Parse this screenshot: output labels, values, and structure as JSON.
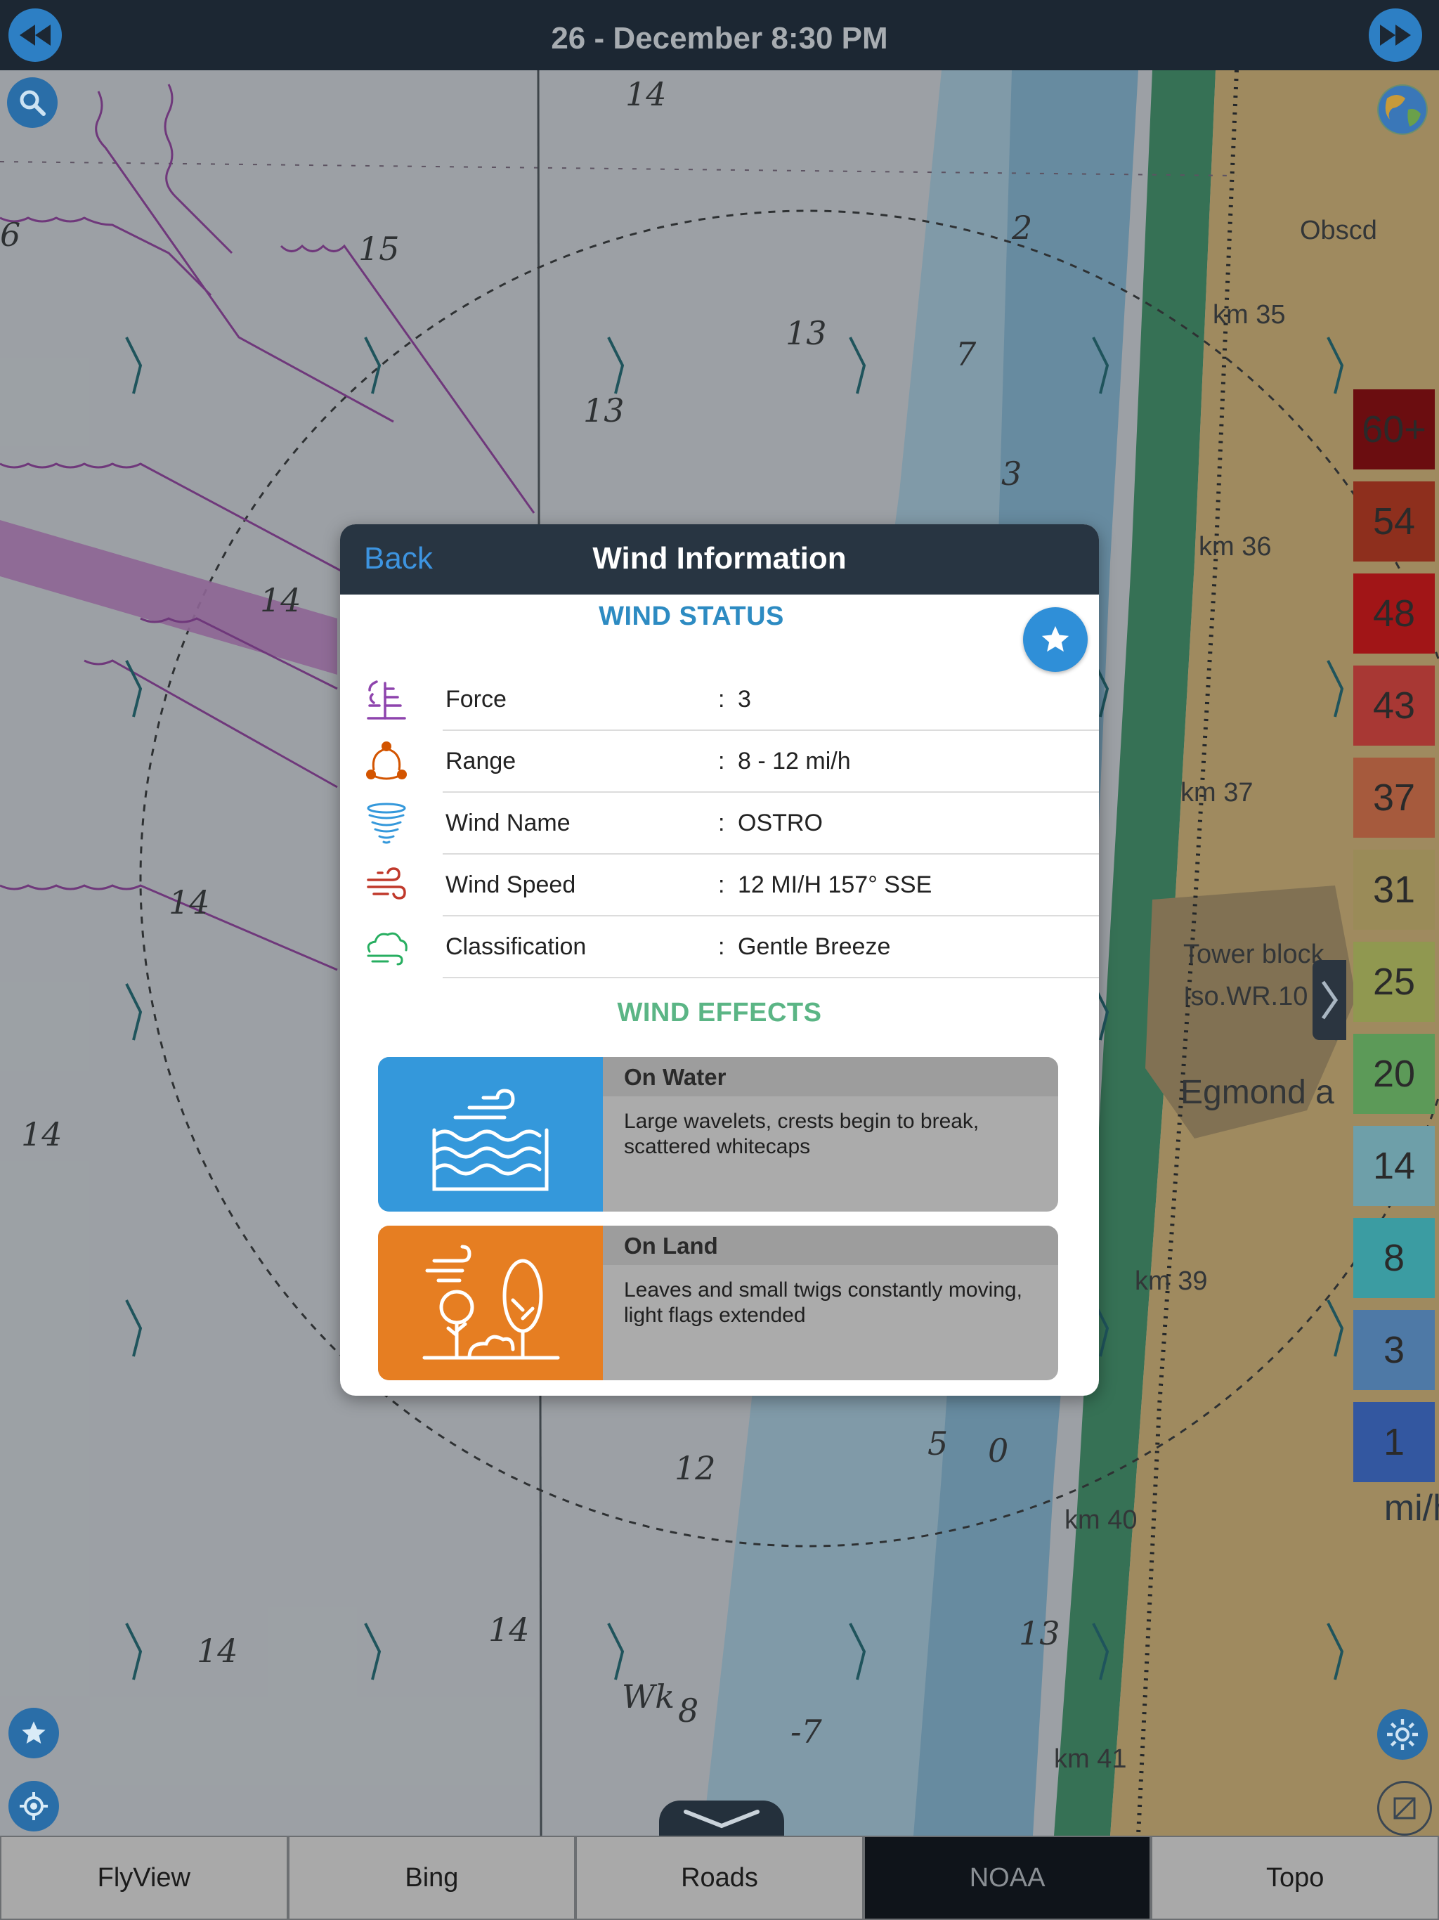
{
  "topbar": {
    "datetime": "26 - December  8:30 PM",
    "prev_icon": "rewind-icon",
    "next_icon": "fast-forward-icon"
  },
  "map": {
    "depth_labels": [
      "14",
      "15",
      "13",
      "13",
      "7",
      "3",
      "6",
      "14",
      "14",
      "14",
      "12",
      "14",
      "14",
      "5",
      "0",
      "2",
      "13",
      "Wk",
      "8",
      "-7"
    ],
    "place_labels": [
      "Obscd",
      "km 35",
      "km 36",
      "km 37",
      "Tower block",
      "Iso.WR.10",
      "Egmond a",
      "km 39",
      "km 40",
      "km 41"
    ]
  },
  "legend": {
    "unit": "mi/h",
    "items": [
      {
        "label": "60+",
        "color": "#6b0d10"
      },
      {
        "label": "54",
        "color": "#8e2f1d"
      },
      {
        "label": "48",
        "color": "#a11517"
      },
      {
        "label": "43",
        "color": "#a83834"
      },
      {
        "label": "37",
        "color": "#a65a3d"
      },
      {
        "label": "31",
        "color": "#9a8b58"
      },
      {
        "label": "25",
        "color": "#909850"
      },
      {
        "label": "20",
        "color": "#5c9a58"
      },
      {
        "label": "14",
        "color": "#6e9fa9"
      },
      {
        "label": "8",
        "color": "#3b9ca2"
      },
      {
        "label": "3",
        "color": "#4e79a6"
      },
      {
        "label": "1",
        "color": "#3357a0"
      }
    ]
  },
  "dialog": {
    "back": "Back",
    "title": "Wind Information",
    "status_title": "WIND STATUS",
    "status_color": "#2d8bc2",
    "effects_title": "WIND EFFECTS",
    "effects_color": "#5bb585",
    "rows": [
      {
        "label": "Force",
        "sep": ":",
        "value": "3",
        "icon": "force-plant-icon",
        "color": "#8e44ad"
      },
      {
        "label": "Range",
        "sep": ":",
        "value": "8 - 12  mi/h",
        "icon": "range-icon",
        "color": "#d35400"
      },
      {
        "label": "Wind Name",
        "sep": ":",
        "value": "OSTRO",
        "icon": "tornado-icon",
        "color": "#3498db"
      },
      {
        "label": "Wind Speed",
        "sep": ":",
        "value": "12 MI/H 157° SSE",
        "icon": "wind-speed-icon",
        "color": "#c0392b"
      },
      {
        "label": "Classification",
        "sep": ":",
        "value": "Gentle Breeze",
        "icon": "cloud-wind-icon",
        "color": "#27ae60"
      }
    ],
    "effects": [
      {
        "title": "On Water",
        "text": "Large wavelets, crests begin to break, scattered whitecaps",
        "icon": "water-waves-icon",
        "color": "#3498db"
      },
      {
        "title": "On Land",
        "text": "Leaves and small twigs constantly moving, light flags extended",
        "icon": "trees-wind-icon",
        "color": "#e67e22"
      }
    ]
  },
  "tabs": [
    {
      "label": "FlyView",
      "active": false
    },
    {
      "label": "Bing",
      "active": false
    },
    {
      "label": "Roads",
      "active": false
    },
    {
      "label": "NOAA",
      "active": true
    },
    {
      "label": "Topo",
      "active": false
    }
  ]
}
